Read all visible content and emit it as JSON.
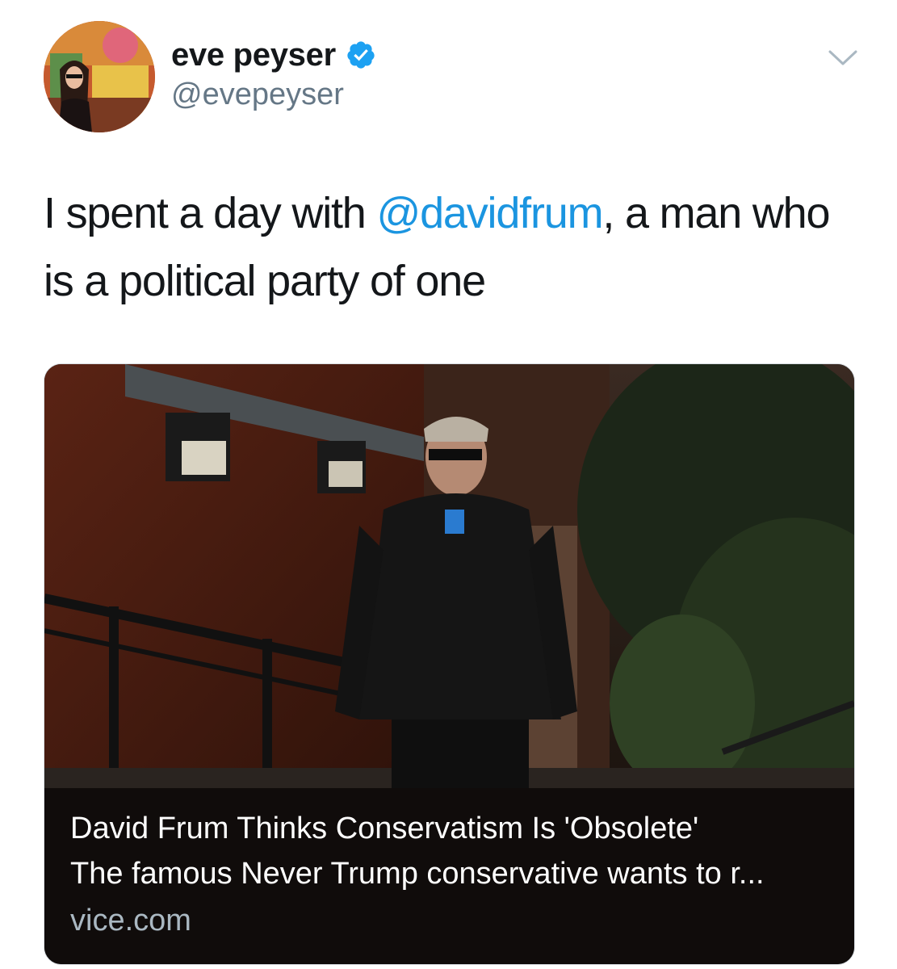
{
  "author": {
    "display_name": "eve peyser",
    "handle": "@evepeyser",
    "verified": true
  },
  "tweet": {
    "text_before": "I spent a day with ",
    "mention": "@davidfrum",
    "text_after": ", a man who is a political party of one"
  },
  "card": {
    "title": "David Frum Thinks Conservatism Is 'Obsolete'",
    "description": "The famous Never Trump conservative wants to r...",
    "domain": "vice.com"
  },
  "colors": {
    "mention": "#1b95e0",
    "handle": "#657786",
    "verified_badge": "#1da1f2",
    "card_background": "#100c0b"
  },
  "icons": {
    "verified": "verified-badge-icon",
    "menu": "chevron-down-icon"
  }
}
